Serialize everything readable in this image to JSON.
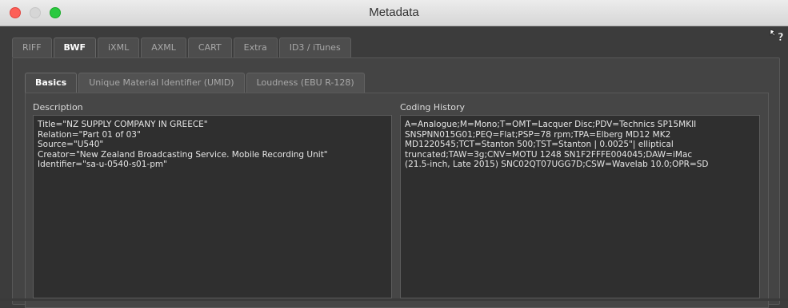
{
  "window": {
    "title": "Metadata"
  },
  "tabs": [
    {
      "label": "RIFF",
      "active": false
    },
    {
      "label": "BWF",
      "active": true
    },
    {
      "label": "iXML",
      "active": false
    },
    {
      "label": "AXML",
      "active": false
    },
    {
      "label": "CART",
      "active": false
    },
    {
      "label": "Extra",
      "active": false
    },
    {
      "label": "ID3 / iTunes",
      "active": false
    }
  ],
  "subtabs": [
    {
      "label": "Basics",
      "active": true
    },
    {
      "label": "Unique Material Identifier (UMID)",
      "active": false
    },
    {
      "label": "Loudness (EBU R-128)",
      "active": false
    }
  ],
  "description": {
    "label": "Description",
    "value": "Title=\"NZ SUPPLY COMPANY IN GREECE\"\nRelation=\"Part 01 of 03\"\nSource=\"U540\"\nCreator=\"New Zealand Broadcasting Service. Mobile Recording Unit\"\nIdentifier=\"sa-u-0540-s01-pm\""
  },
  "coding_history": {
    "label": "Coding History",
    "value": "A=Analogue;M=Mono;T=OMT=Lacquer Disc;PDV=Technics SP15MKII\nSNSPNN015G01;PEQ=Flat;PSP=78 rpm;TPA=Elberg MD12 MK2\nMD1220545;TCT=Stanton 500;TST=Stanton | 0.0025\"| elliptical\ntruncated;TAW=3g;CNV=MOTU 1248 SN1F2FFFE004045;DAW=iMac\n(21.5-inch, Late 2015) SNC02QT07UGG7D;CSW=Wavelab 10.0;OPR=SD"
  },
  "icons": {
    "cursor": "help-cursor-icon"
  },
  "colors": {
    "close": "#fd5f57",
    "zoom": "#2ac940",
    "background": "#3c3c3c"
  }
}
